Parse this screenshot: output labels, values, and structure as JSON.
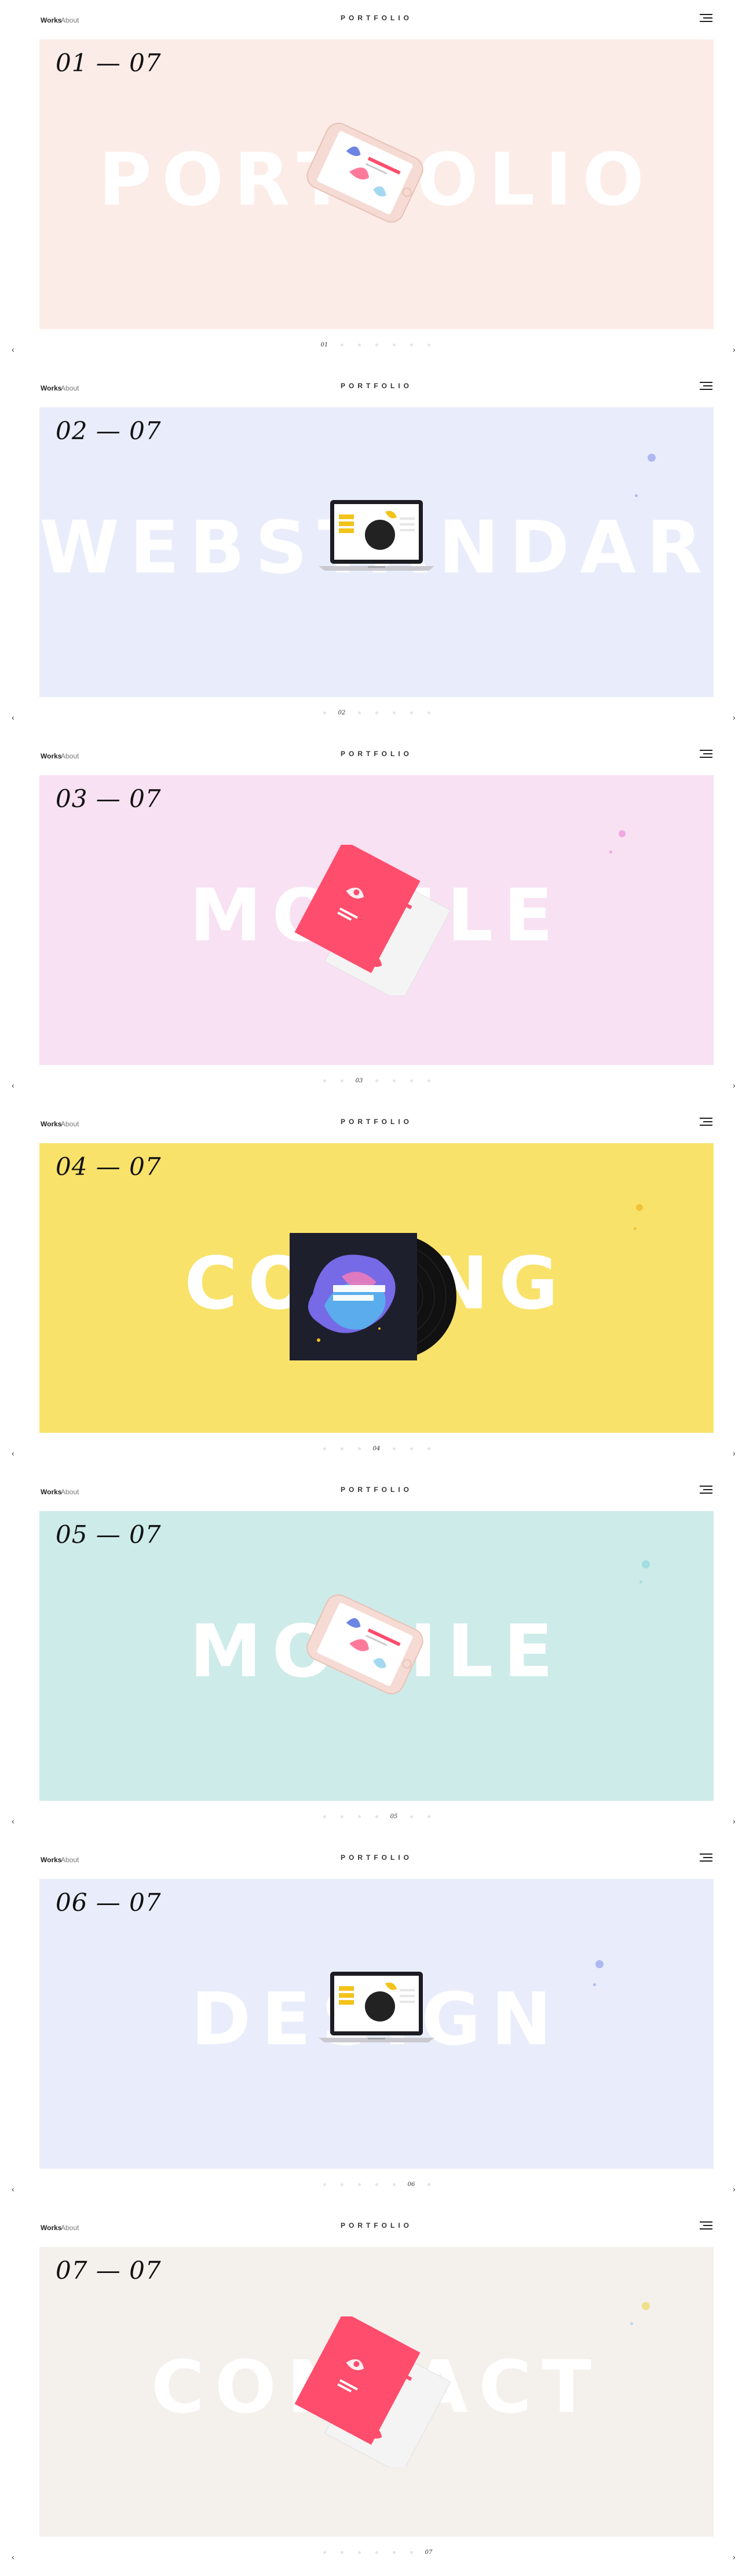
{
  "header": {
    "nav_works": "Works",
    "nav_about": "About",
    "brand": "PORTFOLIO"
  },
  "arrows": {
    "prev": "‹",
    "next": "›"
  },
  "slides": [
    {
      "counter": "01 — 07",
      "word": "PORTFOLIO",
      "bg": "#fcece7",
      "device": "phone",
      "active": 0,
      "page_label": "01",
      "dots": []
    },
    {
      "counter": "02 — 07",
      "word": "WEBSTANDARD",
      "bg": "#e9edfb",
      "device": "laptop",
      "active": 1,
      "page_label": "02",
      "dots": [
        "#aeb9f2",
        "#aeb9f2"
      ]
    },
    {
      "counter": "03 — 07",
      "word": "MOBILE",
      "bg": "#f8e1f3",
      "device": "cards",
      "active": 2,
      "page_label": "03",
      "dots": [
        "#f2a7df",
        "#f2a7df"
      ]
    },
    {
      "counter": "04 — 07",
      "word": "CODING",
      "bg": "#f9e26a",
      "device": "vinyl",
      "active": 3,
      "page_label": "04",
      "dots": [
        "#f2c33a",
        "#f2c33a"
      ]
    },
    {
      "counter": "05 — 07",
      "word": "MOBILE",
      "bg": "#cdebe9",
      "device": "phone",
      "active": 4,
      "page_label": "05",
      "dots": [
        "#a3dde0",
        "#a3dde0"
      ]
    },
    {
      "counter": "06 — 07",
      "word": "DESIGN",
      "bg": "#e9edfb",
      "device": "laptop",
      "active": 5,
      "page_label": "06",
      "dots": [
        "#aeb9f2",
        "#aeb9f2"
      ]
    },
    {
      "counter": "07 — 07",
      "word": "CONTACT",
      "bg": "#f4f0ec",
      "device": "cards",
      "active": 6,
      "page_label": "07",
      "dots": [
        "#f0e08a",
        "#bcd6f4"
      ]
    }
  ]
}
